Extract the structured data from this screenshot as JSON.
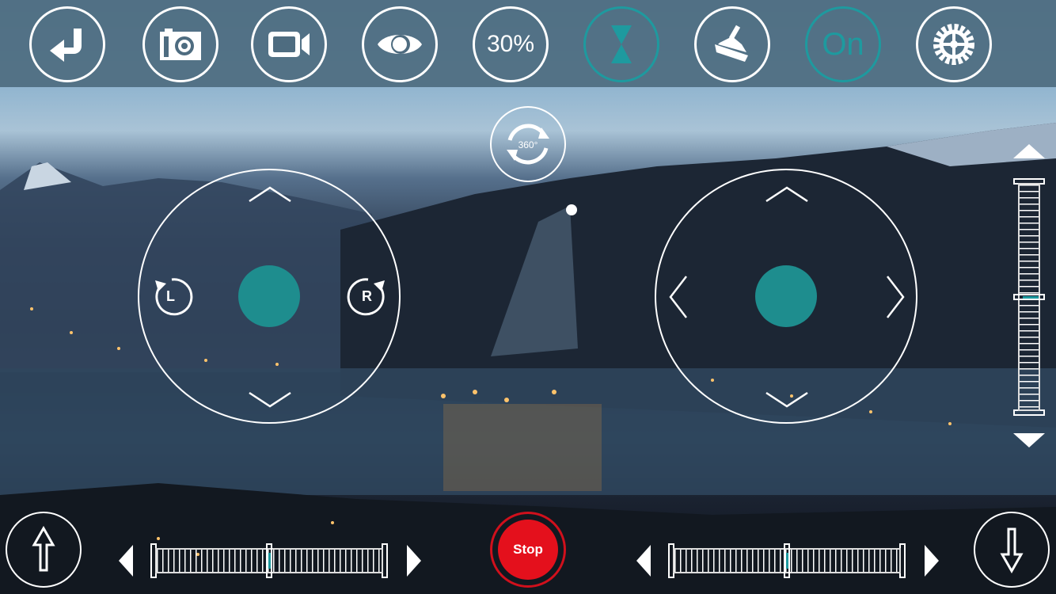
{
  "colors": {
    "accent": "#1e9a9f",
    "stop": "#e4101c",
    "knob": "#1e8d8e"
  },
  "toolbar": {
    "buttons": [
      {
        "icon": "return-arrow-icon",
        "active": false
      },
      {
        "icon": "camera-icon",
        "active": false
      },
      {
        "icon": "video-camera-icon",
        "active": false
      },
      {
        "icon": "eye-icon",
        "active": false
      },
      {
        "label": "30%",
        "active": false
      },
      {
        "icon": "hourglass-icon",
        "active": true
      },
      {
        "icon": "drone-calibrate-icon",
        "active": false
      },
      {
        "label": "On",
        "active": true
      },
      {
        "icon": "gear-icon",
        "active": false
      }
    ]
  },
  "rotate_360": {
    "label": "360°"
  },
  "left_joystick": {
    "rotate_left_label": "L",
    "rotate_right_label": "R"
  },
  "right_joystick": {},
  "vertical_trim": {
    "value": 0.5
  },
  "bottom": {
    "stop_label": "Stop",
    "left_trim": {
      "value": 0.5
    },
    "right_trim": {
      "value": 0.5
    }
  }
}
